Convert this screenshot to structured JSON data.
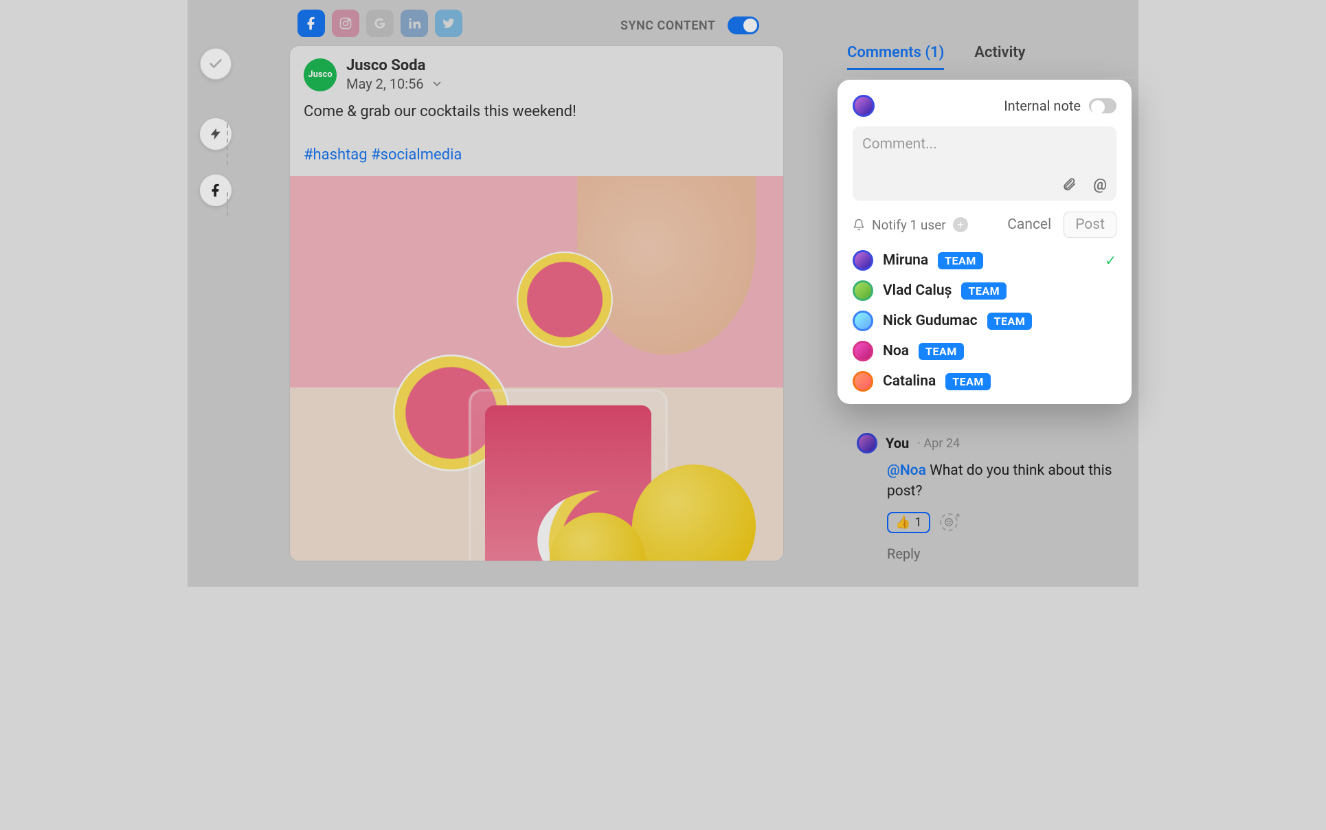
{
  "topbar": {
    "networks": [
      "facebook",
      "instagram",
      "google",
      "linkedin",
      "twitter"
    ],
    "sync_label": "SYNC CONTENT"
  },
  "timeline": {
    "step1": "check",
    "step2": "lightning",
    "step3": "facebook"
  },
  "post": {
    "account": "Jusco Soda",
    "avatar_label": "Jusco",
    "date": "May 2, 10:56",
    "text": "Come & grab our cocktails this weekend!",
    "hashtags": "#hashtag #socialmedia"
  },
  "side": {
    "tabs": {
      "comments": "Comments (1)",
      "activity": "Activity"
    },
    "popover": {
      "note_label": "Internal note",
      "placeholder": "Comment...",
      "notify_label": "Notify 1 user",
      "cancel": "Cancel",
      "post": "Post",
      "users": [
        {
          "name": "Miruna",
          "badge": "TEAM",
          "selected": true
        },
        {
          "name": "Vlad Caluș",
          "badge": "TEAM",
          "selected": false
        },
        {
          "name": "Nick Gudumac",
          "badge": "TEAM",
          "selected": false
        },
        {
          "name": "Noa",
          "badge": "TEAM",
          "selected": false
        },
        {
          "name": "Catalina",
          "badge": "TEAM",
          "selected": false
        }
      ]
    },
    "comment": {
      "author": "You",
      "date": "Apr 24",
      "mention": "@Noa",
      "body": "What do you think about this post?",
      "reaction_emoji": "👍",
      "reaction_count": "1",
      "reply_label": "Reply"
    }
  }
}
